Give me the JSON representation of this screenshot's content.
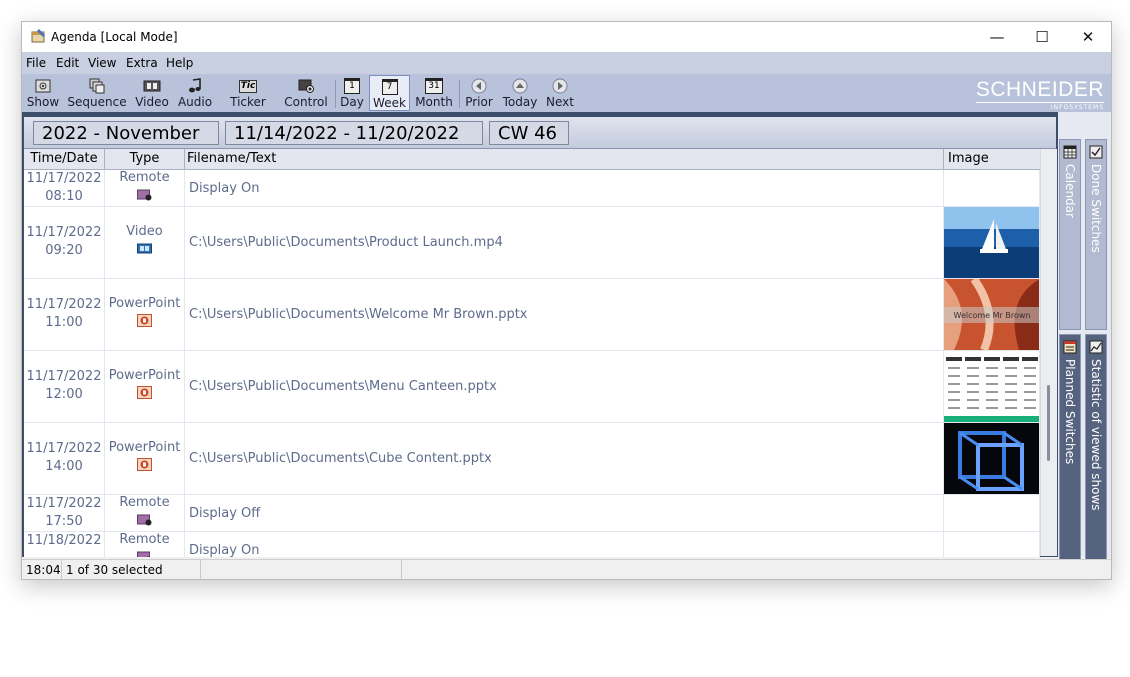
{
  "window": {
    "title": "Agenda [Local Mode]",
    "controls": [
      "—",
      "☐",
      "✕"
    ]
  },
  "menu": [
    "File",
    "Edit",
    "View",
    "Extra",
    "Help"
  ],
  "toolbar": {
    "show": "Show",
    "sequence": "Sequence",
    "video": "Video",
    "audio": "Audio",
    "ticker": "Ticker",
    "control": "Control",
    "day": "Day",
    "week": "Week",
    "month": "Month",
    "prior": "Prior",
    "today": "Today",
    "next": "Next",
    "day_icon_num": "1",
    "week_icon_num": "7",
    "month_icon_num": "31",
    "ticker_icon_text": "Tic"
  },
  "brand": {
    "name": "SCHNEIDER",
    "sub": "INFOSYSTEMS"
  },
  "period": {
    "month": "2022 - November",
    "range": "11/14/2022 - 11/20/2022",
    "week": "CW 46"
  },
  "columns": {
    "time": "Time/Date",
    "type": "Type",
    "file": "Filename/Text",
    "image": "Image"
  },
  "rows": [
    {
      "date": "11/17/2022",
      "time": "08:10",
      "type": "Remote",
      "file": "Display On",
      "image": ""
    },
    {
      "date": "11/17/2022",
      "time": "09:20",
      "type": "Video",
      "file": "C:\\Users\\Public\\Documents\\Product Launch.mp4",
      "image": "sailboat"
    },
    {
      "date": "11/17/2022",
      "time": "11:00",
      "type": "PowerPoint",
      "file": "C:\\Users\\Public\\Documents\\Welcome Mr Brown.pptx",
      "image": "welcome",
      "image_caption": "Welcome Mr Brown"
    },
    {
      "date": "11/17/2022",
      "time": "12:00",
      "type": "PowerPoint",
      "file": "C:\\Users\\Public\\Documents\\Menu Canteen.pptx",
      "image": "menu"
    },
    {
      "date": "11/17/2022",
      "time": "14:00",
      "type": "PowerPoint",
      "file": "C:\\Users\\Public\\Documents\\Cube Content.pptx",
      "image": "cube"
    },
    {
      "date": "11/17/2022",
      "time": "17:50",
      "type": "Remote",
      "file": "Display Off",
      "image": ""
    },
    {
      "date": "11/18/2022",
      "time": "",
      "type": "Remote",
      "file": "Display On",
      "image": ""
    }
  ],
  "side_tabs": {
    "calendar": "Calendar",
    "done": "Done Switches",
    "planned": "Planned Switches",
    "statistic": "Statistic of viewed shows"
  },
  "status": {
    "time": "18:04",
    "selection": "1 of 30 selected"
  },
  "colors": {
    "toolbar": "#b8c2da",
    "menubar": "#c8cfe0",
    "text_muted": "#5e6b8c",
    "dark_panel": "#3e4d6a",
    "sidebar_dark": "#56637f"
  }
}
